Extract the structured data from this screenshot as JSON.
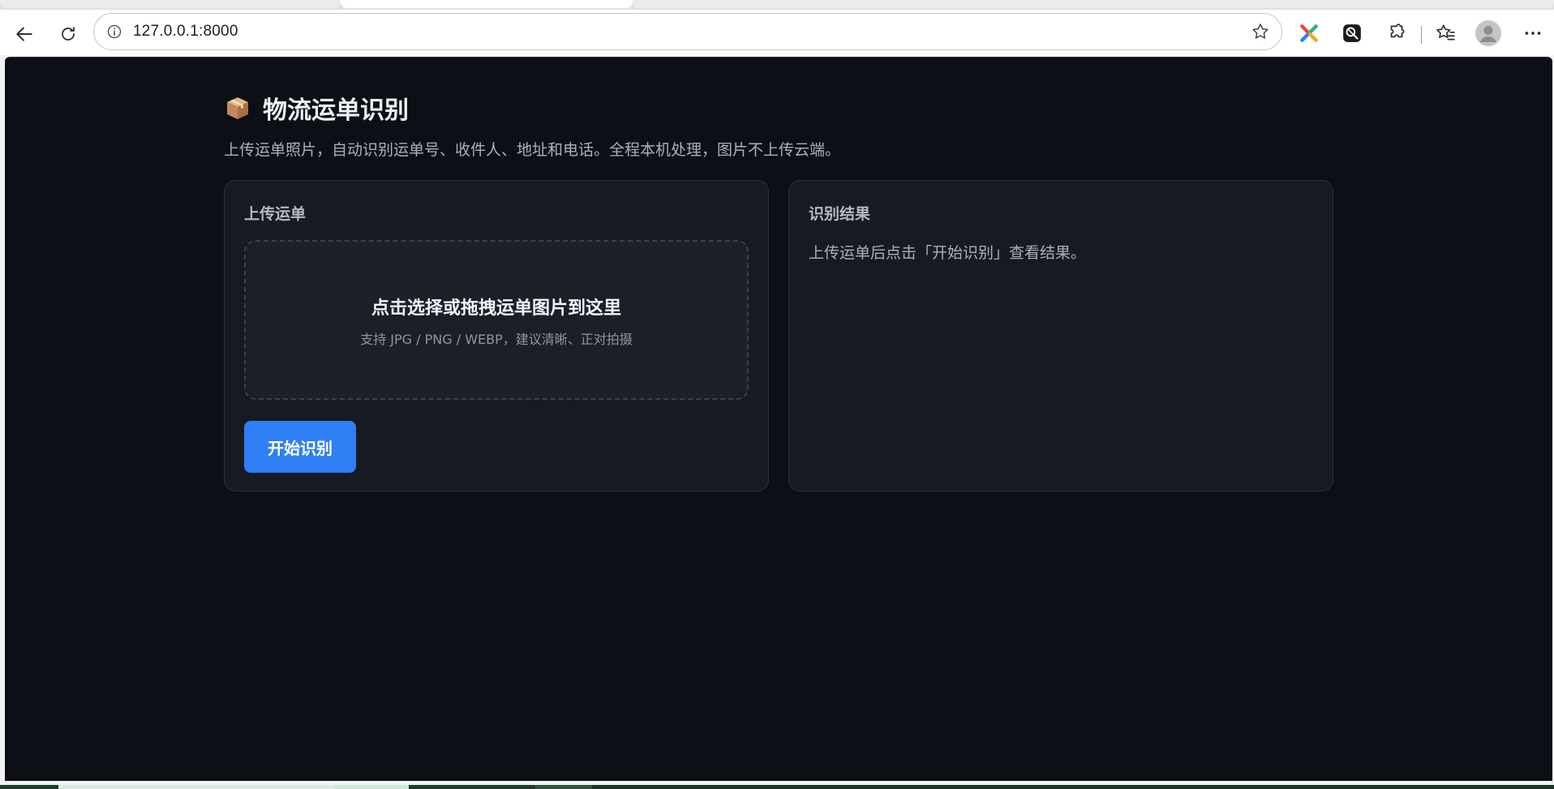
{
  "browser": {
    "url": "127.0.0.1:8000"
  },
  "page": {
    "title": "物流运单识别",
    "subtitle": "上传运单照片，自动识别运单号、收件人、地址和电话。全程本机处理，图片不上传云端。",
    "upload_card": {
      "title": "上传运单",
      "dropzone_main": "点击选择或拖拽运单图片到这里",
      "dropzone_hint": "支持 JPG / PNG / WEBP，建议清晰、正对拍摄",
      "start_button": "开始识别"
    },
    "result_card": {
      "title": "识别结果",
      "placeholder": "上传运单后点击「开始识别」查看结果。"
    }
  },
  "colors": {
    "page_bg": "#0c0f15",
    "card_bg": "#161a22",
    "accent": "#2f7ff5"
  },
  "icons": [
    "back-arrow-icon",
    "reload-icon",
    "info-icon",
    "star-icon",
    "extension-icon",
    "favorites-icon",
    "profile-icon",
    "more-icon",
    "package-icon"
  ]
}
